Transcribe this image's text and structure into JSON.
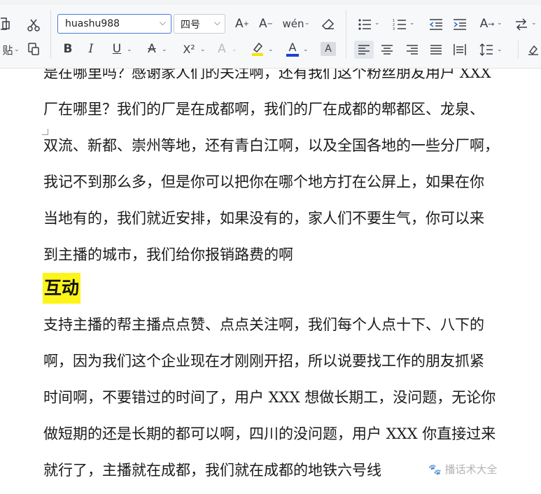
{
  "ribbon": {
    "paste_label": "贴",
    "font_name": "huashu988",
    "font_size": "四号",
    "superscript_label": "X²",
    "toolbar_icons": {
      "row1": [
        "copy-icon",
        "cut-icon",
        "grow-font-icon",
        "shrink-font-icon",
        "phonetic-guide-icon",
        "clear-format-icon",
        "bullets-icon",
        "numbering-icon",
        "decrease-indent-icon",
        "increase-indent-icon",
        "text-direction-icon",
        "sort-icon"
      ],
      "row2": [
        "format-painter-icon",
        "bold-icon",
        "italic-icon",
        "underline-icon",
        "strikethrough-icon",
        "superscript-icon",
        "text-effect-icon",
        "highlight-icon",
        "font-color-icon",
        "char-shading-icon",
        "align-left-icon",
        "align-center-icon",
        "align-right-icon",
        "justify-icon",
        "distributed-icon",
        "line-spacing-icon",
        "styles-icon"
      ]
    },
    "colors": {
      "highlight": "#f5e400",
      "font_color": "#1f3fd1",
      "active_border": "#4a7cd9"
    }
  },
  "document": {
    "paragraph1": [
      "是在哪里吗？感谢家人们的关注啊，还有我们这个粉丝朋友用户 XXX",
      "厂在哪里？我们的厂是在成都啊，我们的厂在成都的郫都区、龙泉、",
      "双流、新都、崇州等地，还有青白江啊，以及全国各地的一些分厂啊，",
      "我记不到那么多，但是你可以把你在哪个地方打在公屏上，如果在你",
      "当地有的，我们就近安排，如果没有的，家人们不要生气，你可以来",
      "到主播的城市，我们给你报销路费的啊"
    ],
    "heading": "互动",
    "heading_highlight": "#fdf51a",
    "paragraph2": [
      "支持主播的帮主播点点赞、点点关注啊，我们每个人点十下、八下的",
      "啊，因为我们这个企业现在才刚刚开招，所以说要找工作的朋友抓紧",
      "时间啊，不要错过的时间了，用户 XXX 想做长期工，没问题，无论你",
      "做短期的还是长期的都可以啊，四川的没问题，用户 XXX 你直接过来",
      "就行了，主播就在成都，我们就在成都的地铁六号线"
    ],
    "watermark": "🐾 播话术大全"
  }
}
